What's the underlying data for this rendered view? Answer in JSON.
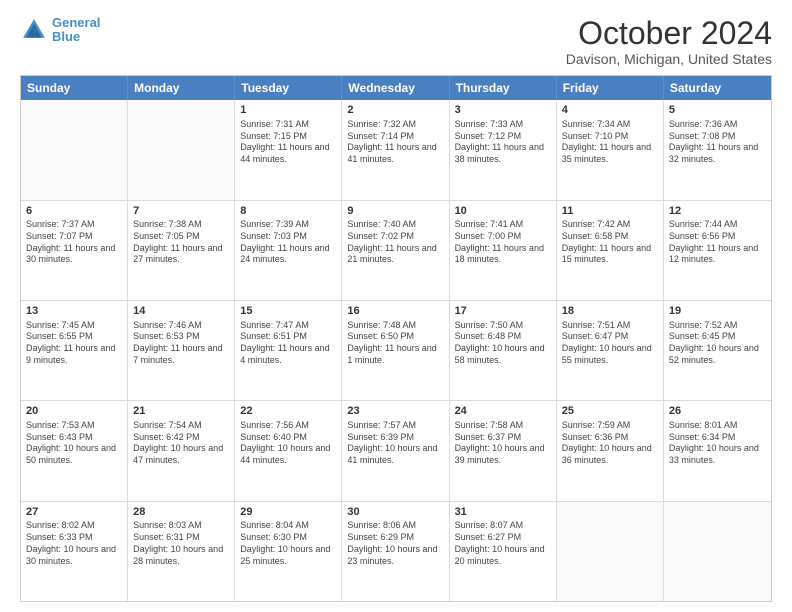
{
  "header": {
    "logo_line1": "General",
    "logo_line2": "Blue",
    "title": "October 2024",
    "subtitle": "Davison, Michigan, United States"
  },
  "days": [
    "Sunday",
    "Monday",
    "Tuesday",
    "Wednesday",
    "Thursday",
    "Friday",
    "Saturday"
  ],
  "rows": [
    [
      {
        "day": "",
        "empty": true
      },
      {
        "day": "",
        "empty": true
      },
      {
        "day": "1",
        "line1": "Sunrise: 7:31 AM",
        "line2": "Sunset: 7:15 PM",
        "line3": "Daylight: 11 hours and 44 minutes."
      },
      {
        "day": "2",
        "line1": "Sunrise: 7:32 AM",
        "line2": "Sunset: 7:14 PM",
        "line3": "Daylight: 11 hours and 41 minutes."
      },
      {
        "day": "3",
        "line1": "Sunrise: 7:33 AM",
        "line2": "Sunset: 7:12 PM",
        "line3": "Daylight: 11 hours and 38 minutes."
      },
      {
        "day": "4",
        "line1": "Sunrise: 7:34 AM",
        "line2": "Sunset: 7:10 PM",
        "line3": "Daylight: 11 hours and 35 minutes."
      },
      {
        "day": "5",
        "line1": "Sunrise: 7:36 AM",
        "line2": "Sunset: 7:08 PM",
        "line3": "Daylight: 11 hours and 32 minutes."
      }
    ],
    [
      {
        "day": "6",
        "line1": "Sunrise: 7:37 AM",
        "line2": "Sunset: 7:07 PM",
        "line3": "Daylight: 11 hours and 30 minutes."
      },
      {
        "day": "7",
        "line1": "Sunrise: 7:38 AM",
        "line2": "Sunset: 7:05 PM",
        "line3": "Daylight: 11 hours and 27 minutes."
      },
      {
        "day": "8",
        "line1": "Sunrise: 7:39 AM",
        "line2": "Sunset: 7:03 PM",
        "line3": "Daylight: 11 hours and 24 minutes."
      },
      {
        "day": "9",
        "line1": "Sunrise: 7:40 AM",
        "line2": "Sunset: 7:02 PM",
        "line3": "Daylight: 11 hours and 21 minutes."
      },
      {
        "day": "10",
        "line1": "Sunrise: 7:41 AM",
        "line2": "Sunset: 7:00 PM",
        "line3": "Daylight: 11 hours and 18 minutes."
      },
      {
        "day": "11",
        "line1": "Sunrise: 7:42 AM",
        "line2": "Sunset: 6:58 PM",
        "line3": "Daylight: 11 hours and 15 minutes."
      },
      {
        "day": "12",
        "line1": "Sunrise: 7:44 AM",
        "line2": "Sunset: 6:56 PM",
        "line3": "Daylight: 11 hours and 12 minutes."
      }
    ],
    [
      {
        "day": "13",
        "line1": "Sunrise: 7:45 AM",
        "line2": "Sunset: 6:55 PM",
        "line3": "Daylight: 11 hours and 9 minutes."
      },
      {
        "day": "14",
        "line1": "Sunrise: 7:46 AM",
        "line2": "Sunset: 6:53 PM",
        "line3": "Daylight: 11 hours and 7 minutes."
      },
      {
        "day": "15",
        "line1": "Sunrise: 7:47 AM",
        "line2": "Sunset: 6:51 PM",
        "line3": "Daylight: 11 hours and 4 minutes."
      },
      {
        "day": "16",
        "line1": "Sunrise: 7:48 AM",
        "line2": "Sunset: 6:50 PM",
        "line3": "Daylight: 11 hours and 1 minute."
      },
      {
        "day": "17",
        "line1": "Sunrise: 7:50 AM",
        "line2": "Sunset: 6:48 PM",
        "line3": "Daylight: 10 hours and 58 minutes."
      },
      {
        "day": "18",
        "line1": "Sunrise: 7:51 AM",
        "line2": "Sunset: 6:47 PM",
        "line3": "Daylight: 10 hours and 55 minutes."
      },
      {
        "day": "19",
        "line1": "Sunrise: 7:52 AM",
        "line2": "Sunset: 6:45 PM",
        "line3": "Daylight: 10 hours and 52 minutes."
      }
    ],
    [
      {
        "day": "20",
        "line1": "Sunrise: 7:53 AM",
        "line2": "Sunset: 6:43 PM",
        "line3": "Daylight: 10 hours and 50 minutes."
      },
      {
        "day": "21",
        "line1": "Sunrise: 7:54 AM",
        "line2": "Sunset: 6:42 PM",
        "line3": "Daylight: 10 hours and 47 minutes."
      },
      {
        "day": "22",
        "line1": "Sunrise: 7:56 AM",
        "line2": "Sunset: 6:40 PM",
        "line3": "Daylight: 10 hours and 44 minutes."
      },
      {
        "day": "23",
        "line1": "Sunrise: 7:57 AM",
        "line2": "Sunset: 6:39 PM",
        "line3": "Daylight: 10 hours and 41 minutes."
      },
      {
        "day": "24",
        "line1": "Sunrise: 7:58 AM",
        "line2": "Sunset: 6:37 PM",
        "line3": "Daylight: 10 hours and 39 minutes."
      },
      {
        "day": "25",
        "line1": "Sunrise: 7:59 AM",
        "line2": "Sunset: 6:36 PM",
        "line3": "Daylight: 10 hours and 36 minutes."
      },
      {
        "day": "26",
        "line1": "Sunrise: 8:01 AM",
        "line2": "Sunset: 6:34 PM",
        "line3": "Daylight: 10 hours and 33 minutes."
      }
    ],
    [
      {
        "day": "27",
        "line1": "Sunrise: 8:02 AM",
        "line2": "Sunset: 6:33 PM",
        "line3": "Daylight: 10 hours and 30 minutes."
      },
      {
        "day": "28",
        "line1": "Sunrise: 8:03 AM",
        "line2": "Sunset: 6:31 PM",
        "line3": "Daylight: 10 hours and 28 minutes."
      },
      {
        "day": "29",
        "line1": "Sunrise: 8:04 AM",
        "line2": "Sunset: 6:30 PM",
        "line3": "Daylight: 10 hours and 25 minutes."
      },
      {
        "day": "30",
        "line1": "Sunrise: 8:06 AM",
        "line2": "Sunset: 6:29 PM",
        "line3": "Daylight: 10 hours and 23 minutes."
      },
      {
        "day": "31",
        "line1": "Sunrise: 8:07 AM",
        "line2": "Sunset: 6:27 PM",
        "line3": "Daylight: 10 hours and 20 minutes."
      },
      {
        "day": "",
        "empty": true
      },
      {
        "day": "",
        "empty": true
      }
    ]
  ]
}
